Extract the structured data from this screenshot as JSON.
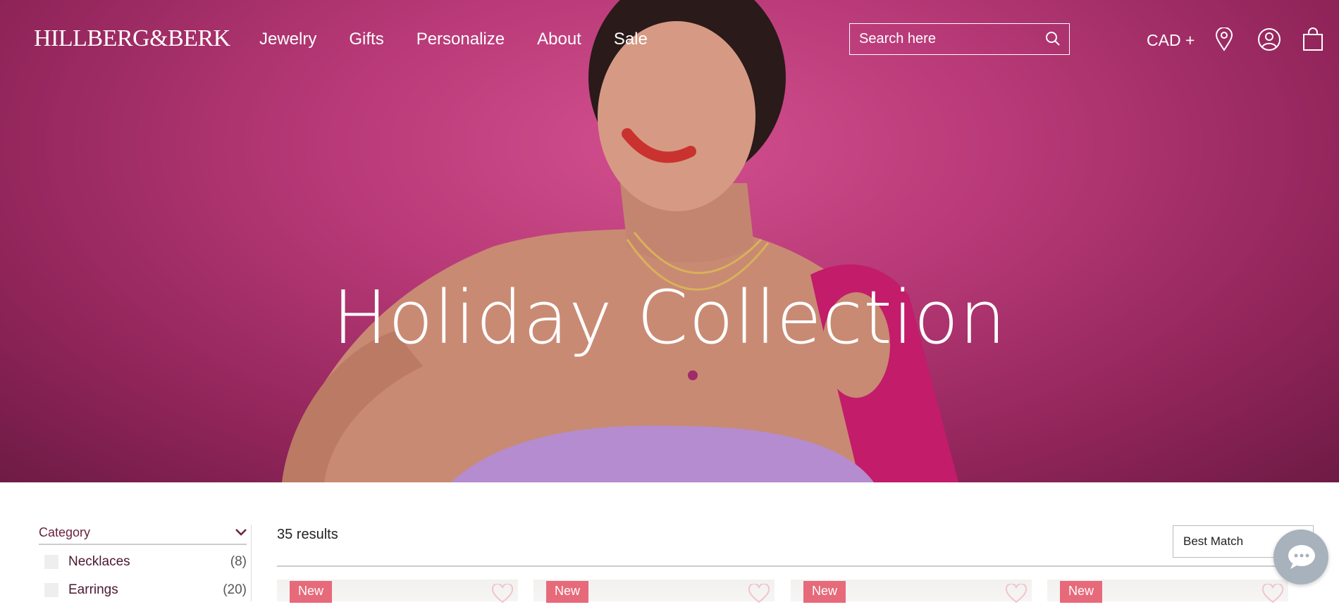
{
  "header": {
    "logo": "HILLBERG&BERK",
    "nav": [
      "Jewelry",
      "Gifts",
      "Personalize",
      "About",
      "Sale"
    ],
    "search_placeholder": "Search here",
    "currency": "CAD +",
    "icons": [
      "search-icon",
      "location-pin-icon",
      "account-icon",
      "shopping-bag-icon"
    ]
  },
  "hero": {
    "title": "Holiday Collection"
  },
  "filters": {
    "category_label": "Category",
    "items": [
      {
        "label": "Necklaces",
        "count": "(8)"
      },
      {
        "label": "Earrings",
        "count": "(20)"
      }
    ]
  },
  "results": {
    "count_text": "35 results",
    "sort_value": "Best Match"
  },
  "products": [
    {
      "badge": "New"
    },
    {
      "badge": "New"
    },
    {
      "badge": "New"
    },
    {
      "badge": "New"
    }
  ],
  "colors": {
    "hero_bg": "#b93a78",
    "badge": "#e76a7a",
    "filter_text": "#6b1f3e",
    "chat_bg": "#a7b2bd"
  }
}
